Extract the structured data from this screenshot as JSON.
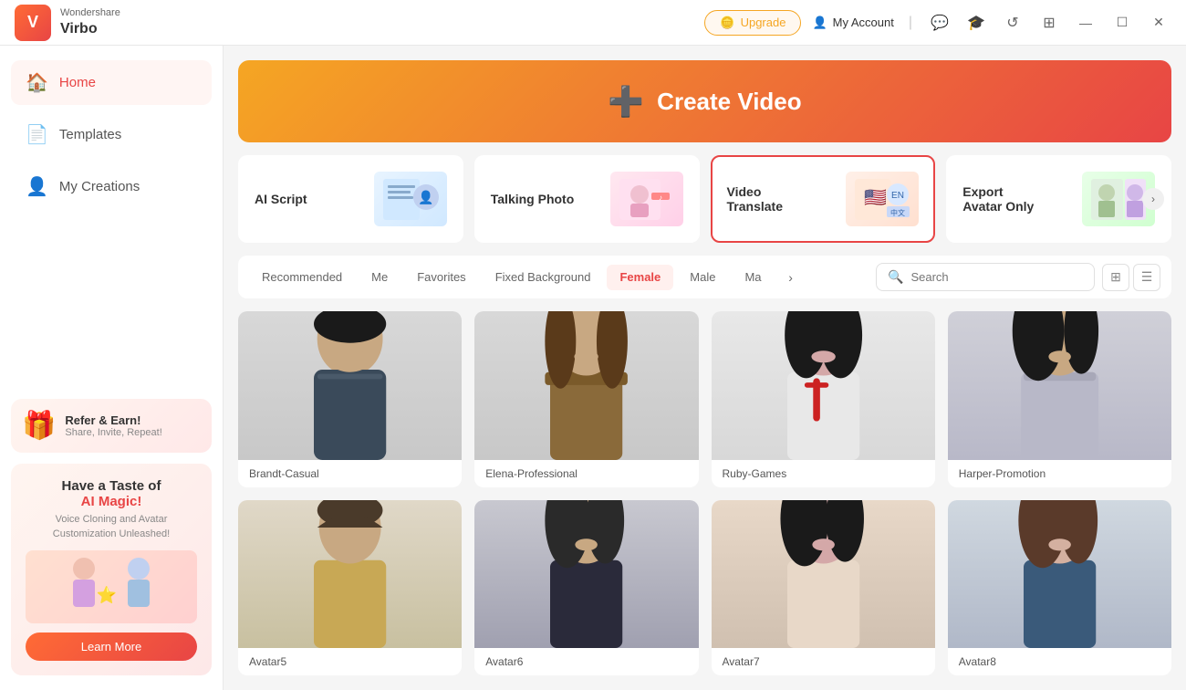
{
  "app": {
    "brand": "Wondershare",
    "name": "Virbo"
  },
  "titlebar": {
    "upgrade_label": "Upgrade",
    "account_label": "My Account"
  },
  "sidebar": {
    "nav_items": [
      {
        "id": "home",
        "label": "Home",
        "active": true
      },
      {
        "id": "templates",
        "label": "Templates",
        "active": false
      },
      {
        "id": "my-creations",
        "label": "My Creations",
        "active": false
      }
    ],
    "refer": {
      "title": "Refer & Earn!",
      "subtitle": "Share, Invite, Repeat!"
    },
    "ai_card": {
      "title": "Have a Taste of",
      "highlight": "AI Magic!",
      "subtitle": "Voice Cloning and\nAvatar Customization Unleashed!",
      "learn_more": "Learn More"
    }
  },
  "banner": {
    "label": "Create Video"
  },
  "features": [
    {
      "id": "ai-script",
      "label": "AI Script",
      "active": false
    },
    {
      "id": "talking-photo",
      "label": "Talking Photo",
      "active": false
    },
    {
      "id": "video-translate",
      "label": "Video\nTranslate",
      "active": true
    },
    {
      "id": "export-avatar",
      "label": "Export\nAvatar Only",
      "active": false
    }
  ],
  "filters": {
    "tabs": [
      {
        "id": "recommended",
        "label": "Recommended",
        "active": false
      },
      {
        "id": "me",
        "label": "Me",
        "active": false
      },
      {
        "id": "favorites",
        "label": "Favorites",
        "active": false
      },
      {
        "id": "fixed-background",
        "label": "Fixed Background",
        "active": false
      },
      {
        "id": "female",
        "label": "Female",
        "active": true
      },
      {
        "id": "male",
        "label": "Male",
        "active": false
      },
      {
        "id": "ma",
        "label": "Ma",
        "active": false
      }
    ],
    "search_placeholder": "Search"
  },
  "avatars": [
    {
      "id": 1,
      "name": "Brandt-Casual",
      "gender": "male",
      "skin": "#c8a882",
      "hair": "#1a1a1a",
      "outfit": "#3a4a5a"
    },
    {
      "id": 2,
      "name": "Elena-Professional",
      "gender": "female",
      "skin": "#c8a882",
      "hair": "#5a3a1a",
      "outfit": "#8a6a3a"
    },
    {
      "id": 3,
      "name": "Ruby-Games",
      "gender": "female",
      "skin": "#d4a8a8",
      "hair": "#1a1a1a",
      "outfit": "#e8e8e8",
      "tie": "#cc2222"
    },
    {
      "id": 4,
      "name": "Harper-Promotion",
      "gender": "female",
      "skin": "#c8a882",
      "hair": "#1a1a1a",
      "outfit": "#b8b8c8"
    },
    {
      "id": 5,
      "name": "Avatar5",
      "gender": "male",
      "skin": "#c8a882",
      "hair": "#4a3a2a",
      "outfit": "#c8a855"
    },
    {
      "id": 6,
      "name": "Avatar6",
      "gender": "female",
      "skin": "#c8a882",
      "hair": "#2a2a2a",
      "outfit": "#2a2a3a"
    },
    {
      "id": 7,
      "name": "Avatar7",
      "gender": "female",
      "skin": "#d4a8a8",
      "hair": "#1a1a1a",
      "outfit": "#e8d8c8"
    },
    {
      "id": 8,
      "name": "Avatar8",
      "gender": "female",
      "skin": "#d4b0a0",
      "hair": "#5a3a2a",
      "outfit": "#3a5a7a"
    }
  ]
}
